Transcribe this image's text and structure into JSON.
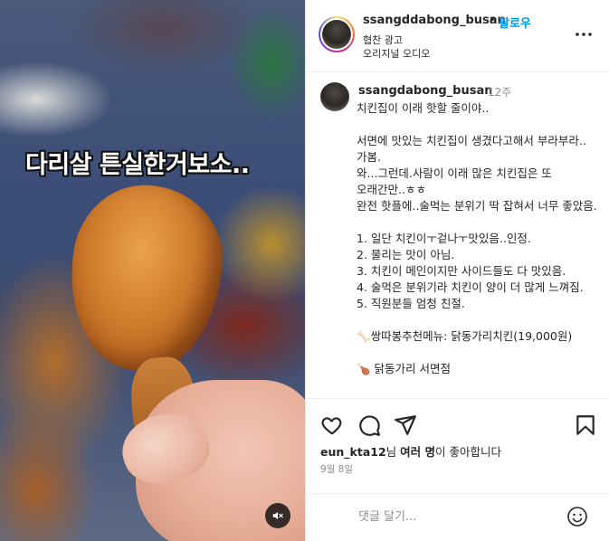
{
  "media": {
    "caption": "다리살 튼실한거보소..",
    "mute_icon": "speaker-muted-icon"
  },
  "header": {
    "username": "ssangddabong_busan",
    "separator": "•",
    "follow_label": "팔로우",
    "sponsored_label": "협찬 광고",
    "audio_label": "오리지널 오디오",
    "more_icon": "more-horizontal-icon"
  },
  "comment": {
    "username": "ssangdabong_busan",
    "time": "12주",
    "text": "치킨집이 이래 핫할 줄이야..\n\n서면에 맛있는 치킨집이 생겼다고해서 부라부라..가봄.\n와...그런데.사람이 이래 많은 치킨집은 또 오래간만..ㅎㅎ\n완전 핫플에..술먹는 분위기 딱 잡혀서 너무 좋았음.\n\n1. 일단 치킨이ㅜ겉나ㅜ맛있음..인정.\n2. 물리는 맛이 아님.\n3. 치킨이 메인이지만 사이드들도 다 맛있음.\n4. 술먹은 분위기라 치킨이 양이 더 많게 느껴짐.\n5. 직원분들 엄청 친절.\n\n🦴쌍따봉추천메뉴: 닭동가리치킨(19,000원)\n\n🍗 닭동가리 서면점"
  },
  "actions": {
    "like_icon": "heart-icon",
    "comment_icon": "comment-bubble-icon",
    "share_icon": "send-paper-plane-icon",
    "save_icon": "bookmark-icon",
    "likes_user": "eun_kta12",
    "likes_mid": "님 ",
    "likes_count": "여러 명",
    "likes_tail": "이 좋아합니다",
    "date": "9월 8일"
  },
  "comment_box": {
    "placeholder": "댓글 달기...",
    "emoji_icon": "emoji-smile-icon"
  }
}
